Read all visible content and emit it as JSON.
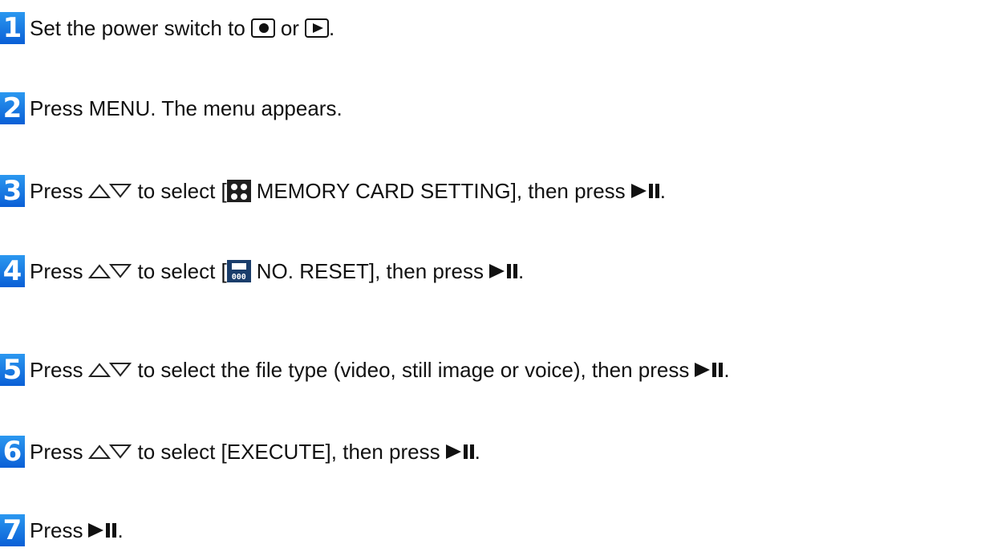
{
  "steps": [
    {
      "num": "1",
      "parts": [
        "Set the power switch to",
        "or",
        "."
      ]
    },
    {
      "num": "2",
      "parts": [
        "Press MENU. The menu appears."
      ]
    },
    {
      "num": "3",
      "parts": [
        "Press",
        "to select [",
        "MEMORY CARD SETTING], then press",
        "."
      ]
    },
    {
      "num": "4",
      "parts": [
        "Press",
        "to select [",
        "NO. RESET], then press",
        "."
      ]
    },
    {
      "num": "5",
      "parts": [
        "Press",
        "to select the file type (video, still image or voice), then press",
        "."
      ]
    },
    {
      "num": "6",
      "parts": [
        "Press",
        "to select [EXECUTE], then press",
        "."
      ]
    },
    {
      "num": "7",
      "parts": [
        "Press",
        "."
      ]
    }
  ],
  "icons": {
    "record": "record-mode-icon",
    "playback": "playback-mode-icon",
    "updown": "up-down-arrows-icon",
    "playpause": "play-pause-icon",
    "card": "memory-card-setting-icon",
    "reset": "number-reset-icon"
  },
  "colors": {
    "badge": "#1a7de8",
    "text": "#111111"
  }
}
